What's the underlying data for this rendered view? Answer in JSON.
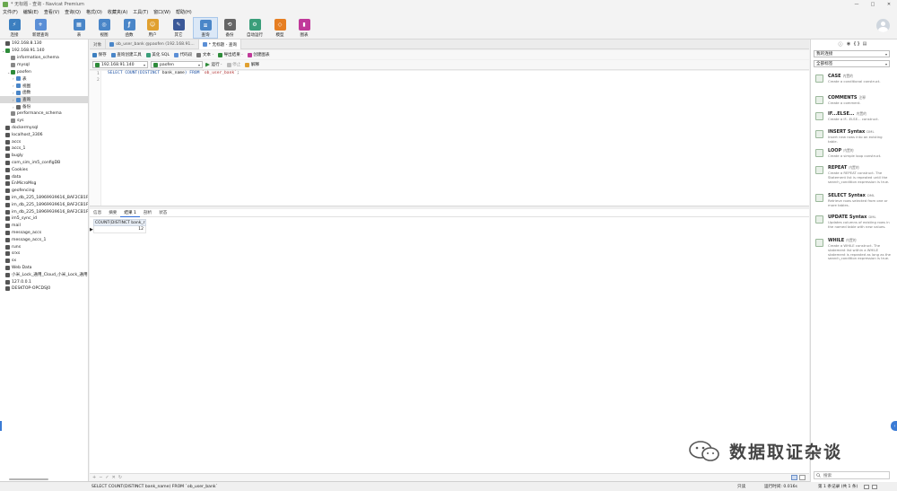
{
  "window": {
    "title": "* 无标题 - 查询 - Navicat Premium",
    "controls": [
      "—",
      "□",
      "✕"
    ]
  },
  "menu": [
    "文件(F)",
    "编辑(E)",
    "查看(V)",
    "查询(Q)",
    "格式(O)",
    "收藏夹(A)",
    "工具(T)",
    "窗口(W)",
    "帮助(H)"
  ],
  "toolbar": [
    {
      "label": "连接",
      "icon": "connection-icon",
      "color": "#3c7fc0"
    },
    {
      "label": "新建查询",
      "icon": "new-query-icon",
      "color": "#5b8fd6"
    },
    {
      "label": "表",
      "icon": "table-icon",
      "color": "#4a86c8"
    },
    {
      "label": "视图",
      "icon": "view-icon",
      "color": "#4a86c8"
    },
    {
      "label": "函数",
      "icon": "function-icon",
      "color": "#4a86c8"
    },
    {
      "label": "用户",
      "icon": "user-icon",
      "color": "#e0a030"
    },
    {
      "label": "其它",
      "icon": "tools-icon",
      "color": "#3b5998"
    },
    {
      "label": "查询",
      "icon": "query-icon",
      "color": "#4a86c8"
    },
    {
      "label": "备份",
      "icon": "backup-icon",
      "color": "#666666"
    },
    {
      "label": "自动运行",
      "icon": "automation-icon",
      "color": "#3a9e7a"
    },
    {
      "label": "模型",
      "icon": "model-icon",
      "color": "#e67e22"
    },
    {
      "label": "图表",
      "icon": "chart-icon",
      "color": "#c0399a"
    }
  ],
  "sidebar": [
    {
      "label": "192.168.8.130",
      "icon": "server-icon",
      "color": "#555"
    },
    {
      "label": "192.168.91.140",
      "icon": "server-icon",
      "color": "#2e8b3a",
      "expanded": true
    },
    {
      "label": "information_schema",
      "icon": "database-icon",
      "color": "#888"
    },
    {
      "label": "mysql",
      "icon": "database-icon",
      "color": "#888"
    },
    {
      "label": "paofen",
      "icon": "database-icon",
      "color": "#2e8b3a",
      "expanded": true
    },
    {
      "label": "表",
      "icon": "table-icon",
      "color": "#4a86c8"
    },
    {
      "label": "视图",
      "icon": "view-icon",
      "color": "#4a86c8"
    },
    {
      "label": "函数",
      "icon": "function-icon",
      "color": "#4a86c8"
    },
    {
      "label": "查询",
      "icon": "query-icon",
      "color": "#4a86c8"
    },
    {
      "label": "备份",
      "icon": "backup-icon",
      "color": "#666"
    },
    {
      "label": "performance_schema",
      "icon": "database-icon",
      "color": "#888"
    },
    {
      "label": "sys",
      "icon": "database-icon",
      "color": "#888"
    },
    {
      "label": "dockermysql",
      "icon": "server-icon",
      "color": "#555"
    },
    {
      "label": "localhost_3306",
      "icon": "server-icon",
      "color": "#555"
    },
    {
      "label": "accs",
      "icon": "server-icon",
      "color": "#555"
    },
    {
      "label": "accs_1",
      "icon": "server-icon",
      "color": "#555"
    },
    {
      "label": "bugly",
      "icon": "server-icon",
      "color": "#555"
    },
    {
      "label": "com_sim_im5_configDB",
      "icon": "server-icon",
      "color": "#555"
    },
    {
      "label": "Cookies",
      "icon": "server-icon",
      "color": "#555"
    },
    {
      "label": "data",
      "icon": "server-icon",
      "color": "#555"
    },
    {
      "label": "EnMicroMsg",
      "icon": "server-icon",
      "color": "#555"
    },
    {
      "label": "geofencing",
      "icon": "server-icon",
      "color": "#555"
    },
    {
      "label": "im_db_225_18969939616_BAF2CB1F-",
      "icon": "server-icon",
      "color": "#555"
    },
    {
      "label": "im_db_225_18969939616_BAF2CB1F-",
      "icon": "server-icon",
      "color": "#555"
    },
    {
      "label": "im_db_225_18969939616_BAF2CB1F-",
      "icon": "server-icon",
      "color": "#555"
    },
    {
      "label": "im5_sync_id",
      "icon": "server-icon",
      "color": "#555"
    },
    {
      "label": "mail",
      "icon": "server-icon",
      "color": "#555"
    },
    {
      "label": "message_accs",
      "icon": "server-icon",
      "color": "#555"
    },
    {
      "label": "message_accs_1",
      "icon": "server-icon",
      "color": "#555"
    },
    {
      "label": "runs",
      "icon": "server-icon",
      "color": "#555"
    },
    {
      "label": "srxs",
      "icon": "server-icon",
      "color": "#555"
    },
    {
      "label": "sx",
      "icon": "server-icon",
      "color": "#555"
    },
    {
      "label": "Web Data",
      "icon": "server-icon",
      "color": "#555"
    },
    {
      "label": "小米_Lock_通用_Cloud_小米_Lock_通用",
      "icon": "server-icon",
      "color": "#555"
    },
    {
      "label": "127.0.0.1",
      "icon": "server-icon",
      "color": "#555"
    },
    {
      "label": "DESKTOP-OPCDSJ0",
      "icon": "server-icon",
      "color": "#555"
    }
  ],
  "tabs": [
    {
      "label": "对象"
    },
    {
      "label": "ob_user_bank @paofen (192.168.91..."
    },
    {
      "label": "* 无标题 - 查询"
    }
  ],
  "query_toolbar": [
    {
      "label": "保存",
      "icon": "save-icon"
    },
    {
      "label": "查询创建工具",
      "icon": "query-builder-icon"
    },
    {
      "label": "美化 SQL",
      "icon": "beautify-icon"
    },
    {
      "label": "代码段",
      "icon": "snippet-icon"
    },
    {
      "label": "文本 ·",
      "icon": "text-icon"
    },
    {
      "label": "导出结果 ·",
      "icon": "export-icon"
    },
    {
      "label": "创建图表",
      "icon": "create-chart-icon"
    }
  ],
  "connection_bar": {
    "connection": "192.168.91.140",
    "database": "paofen",
    "run_label": "运行 ·",
    "stop_label": "停止",
    "explain_label": "解释"
  },
  "editor": {
    "line_numbers": [
      "1",
      "2"
    ],
    "sql": {
      "kw1": "SELECT COUNT(DISTINCT ",
      "col": "bank_name",
      "kw2": ") FROM ",
      "str": "`ob_user_bank`",
      "end": ";"
    }
  },
  "result_tabs": [
    "信息",
    "摘要",
    "结果 1",
    "剖析",
    "状态"
  ],
  "result": {
    "column": "COUNT(DISTINCT bank_r",
    "value": "12"
  },
  "result_footer": [
    "+",
    "−",
    "✓",
    "✕",
    "↻"
  ],
  "status": {
    "sql": "SELECT COUNT(DISTINCT bank_name) FROM `ob_user_bank`",
    "readonly": "只读",
    "runtime": "运行时间: 0.016s",
    "record": "第 1 条记录 (共 1 条)"
  },
  "right_panel": {
    "filter_label": "我的连接",
    "tag_label": "全部标签",
    "snippets": [
      {
        "name": "CASE",
        "tag": "内置的",
        "desc": "Create a conditional construct."
      },
      {
        "name": "COMMENTS",
        "tag": "注释",
        "desc": "Create a comment."
      },
      {
        "name": "IF...ELSE...",
        "tag": "内置的",
        "desc": "Create a IF...ELSE... construct."
      },
      {
        "name": "INSERT Syntax",
        "tag": "DML",
        "desc": "Insert new rows into an existing table."
      },
      {
        "name": "LOOP",
        "tag": "内置的",
        "desc": "Create a simple loop construct."
      },
      {
        "name": "REPEAT",
        "tag": "内置的",
        "desc": "Create a REPEAT construct. The Statement list is repeated until the search_condition expression is true."
      },
      {
        "name": "SELECT Syntax",
        "tag": "DML",
        "desc": "Retrieve rows selected from one or more tables."
      },
      {
        "name": "UPDATE Syntax",
        "tag": "DML",
        "desc": "Updates columns of existing rows in the named table with new values."
      },
      {
        "name": "WHILE",
        "tag": "内置的",
        "desc": "Create a WHILE construct. The statement list within a WHILE statement is repeated as long as the search_condition expression is true."
      }
    ],
    "search_placeholder": "搜索"
  },
  "watermark": "数据取证杂谈"
}
